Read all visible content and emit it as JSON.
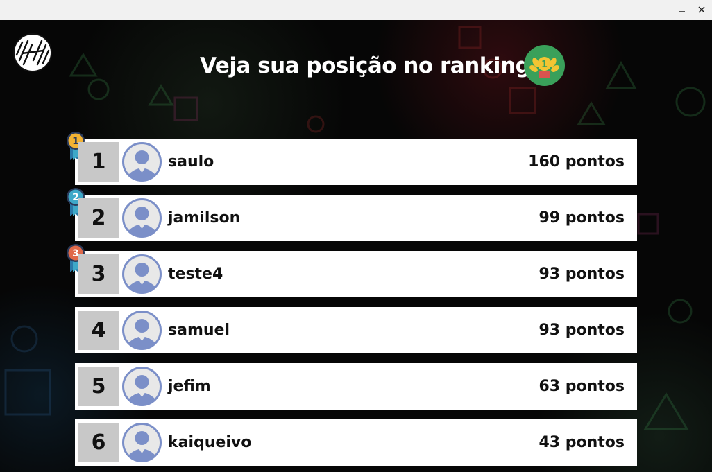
{
  "window": {
    "minimize_icon": "minimize-icon",
    "close_icon": "close-icon"
  },
  "header": {
    "title": "Veja sua posição no ranking",
    "logo_icon": "app-logo-icon",
    "badge_icon": "trophy-laurel-icon"
  },
  "colors": {
    "background": "#060606",
    "row_background": "#ffffff",
    "position_box": "#c8c8c8",
    "avatar": "#7b8fc8",
    "badge": "#3aa05a",
    "medal_gold": "#f2b233",
    "medal_silver": "#3ea8c8",
    "medal_bronze": "#e0694a",
    "ribbon": "#2a78a8"
  },
  "ranking": [
    {
      "position": "1",
      "name": "saulo",
      "score": "160 pontos",
      "medal": "1"
    },
    {
      "position": "2",
      "name": "jamilson",
      "score": "99 pontos",
      "medal": "2"
    },
    {
      "position": "3",
      "name": "teste4",
      "score": "93 pontos",
      "medal": "3"
    },
    {
      "position": "4",
      "name": "samuel",
      "score": "93 pontos"
    },
    {
      "position": "5",
      "name": "jefim",
      "score": "63 pontos"
    },
    {
      "position": "6",
      "name": "kaiqueivo",
      "score": "43 pontos"
    }
  ]
}
